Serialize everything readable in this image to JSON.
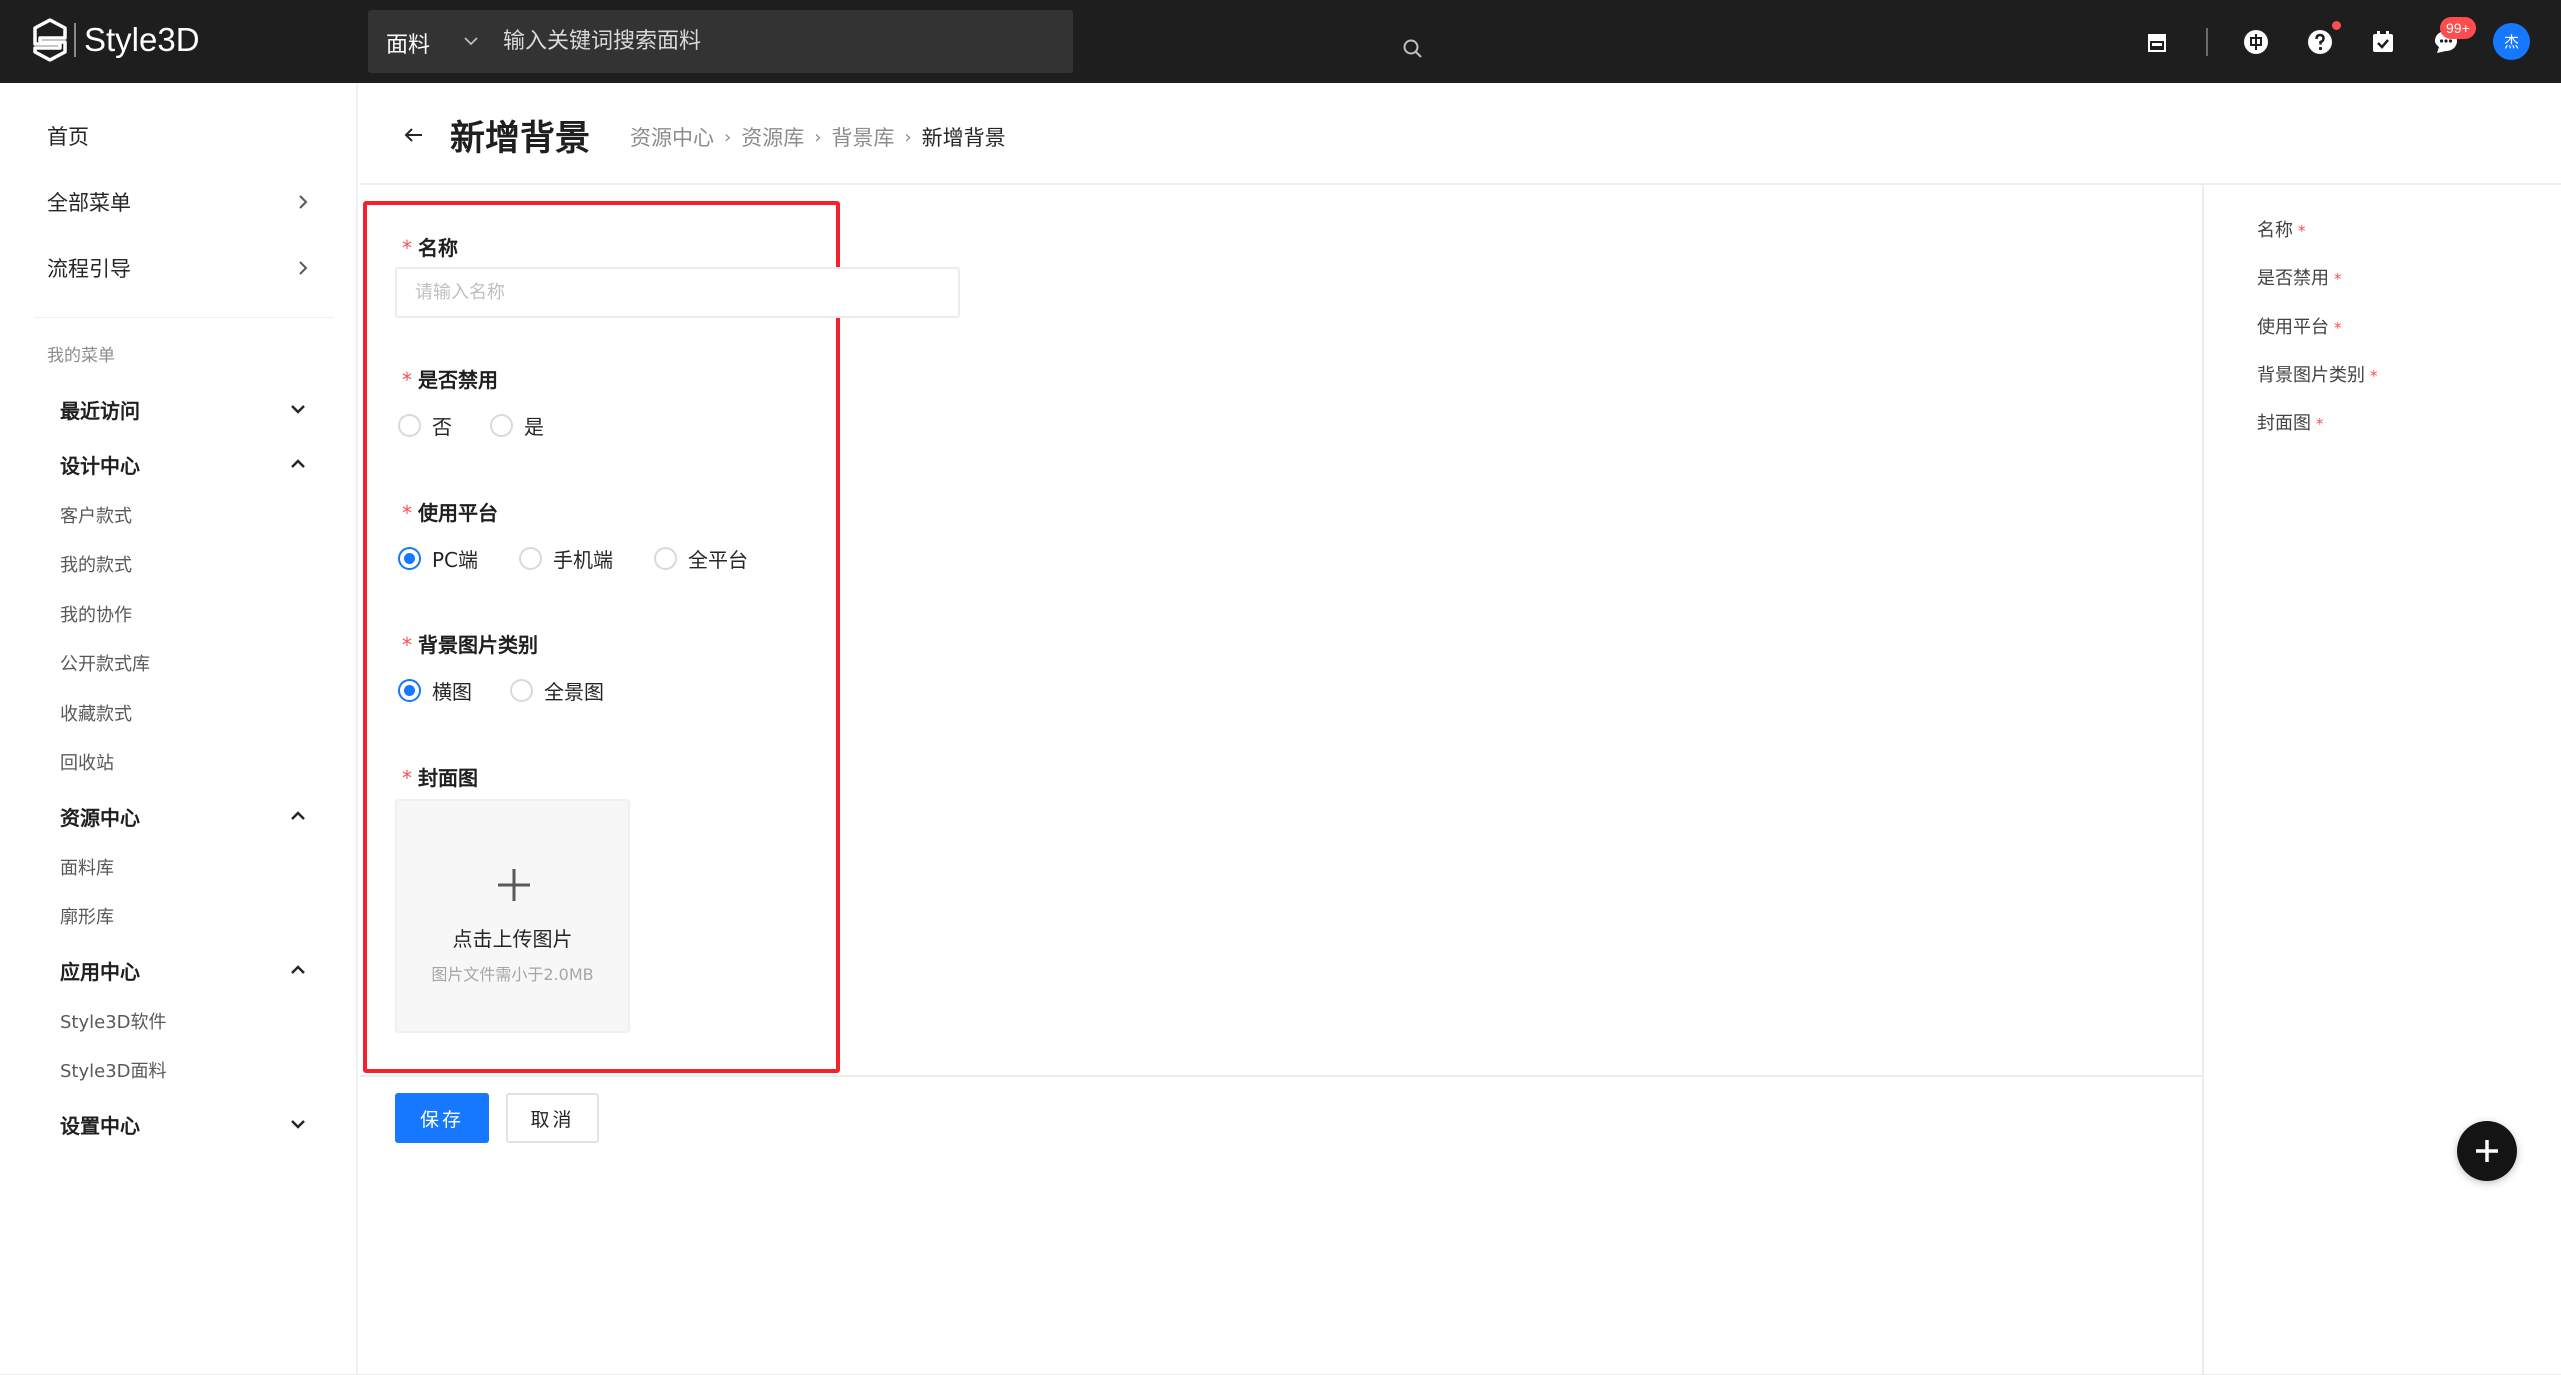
{
  "brand": {
    "name": "Style3D"
  },
  "search": {
    "category": "面料",
    "placeholder": "输入关键词搜索面料"
  },
  "topbar": {
    "icons": [
      "store-icon",
      "language-icon",
      "help-icon",
      "tasks-icon",
      "message-icon"
    ],
    "language_label": "中",
    "message_badge": "99+",
    "avatar_label": "杰"
  },
  "sidebar": {
    "home": "首页",
    "all_menu": "全部菜单",
    "flow_guide": "流程引导",
    "my_menu_caption": "我的菜单",
    "groups": [
      {
        "title": "最近访问",
        "expanded": false,
        "items": []
      },
      {
        "title": "设计中心",
        "expanded": true,
        "items": [
          "客户款式",
          "我的款式",
          "我的协作",
          "公开款式库",
          "收藏款式",
          "回收站"
        ]
      },
      {
        "title": "资源中心",
        "expanded": true,
        "items": [
          "面料库",
          "廓形库"
        ]
      },
      {
        "title": "应用中心",
        "expanded": true,
        "items": [
          "Style3D软件",
          "Style3D面料"
        ]
      },
      {
        "title": "设置中心",
        "expanded": false,
        "items": []
      }
    ]
  },
  "header": {
    "title": "新增背景",
    "breadcrumb": [
      "资源中心",
      "资源库",
      "背景库",
      "新增背景"
    ]
  },
  "form": {
    "required_mark": "*",
    "name": {
      "label": "名称",
      "placeholder": "请输入名称",
      "value": ""
    },
    "disabled": {
      "label": "是否禁用",
      "options": [
        "否",
        "是"
      ],
      "selected": null
    },
    "platform": {
      "label": "使用平台",
      "options": [
        "PC端",
        "手机端",
        "全平台"
      ],
      "selected": "PC端"
    },
    "bg_type": {
      "label": "背景图片类别",
      "options": [
        "横图",
        "全景图"
      ],
      "selected": "横图"
    },
    "cover": {
      "label": "封面图",
      "upload_text": "点击上传图片",
      "upload_hint": "图片文件需小于2.0MB"
    },
    "save_label": "保存",
    "cancel_label": "取消"
  },
  "anchors": [
    "名称",
    "是否禁用",
    "使用平台",
    "背景图片类别",
    "封面图"
  ],
  "colors": {
    "primary": "#1677ff",
    "required": "#ff4d4f",
    "highlight": "#f5222d",
    "topbar": "#1e1e1e"
  }
}
